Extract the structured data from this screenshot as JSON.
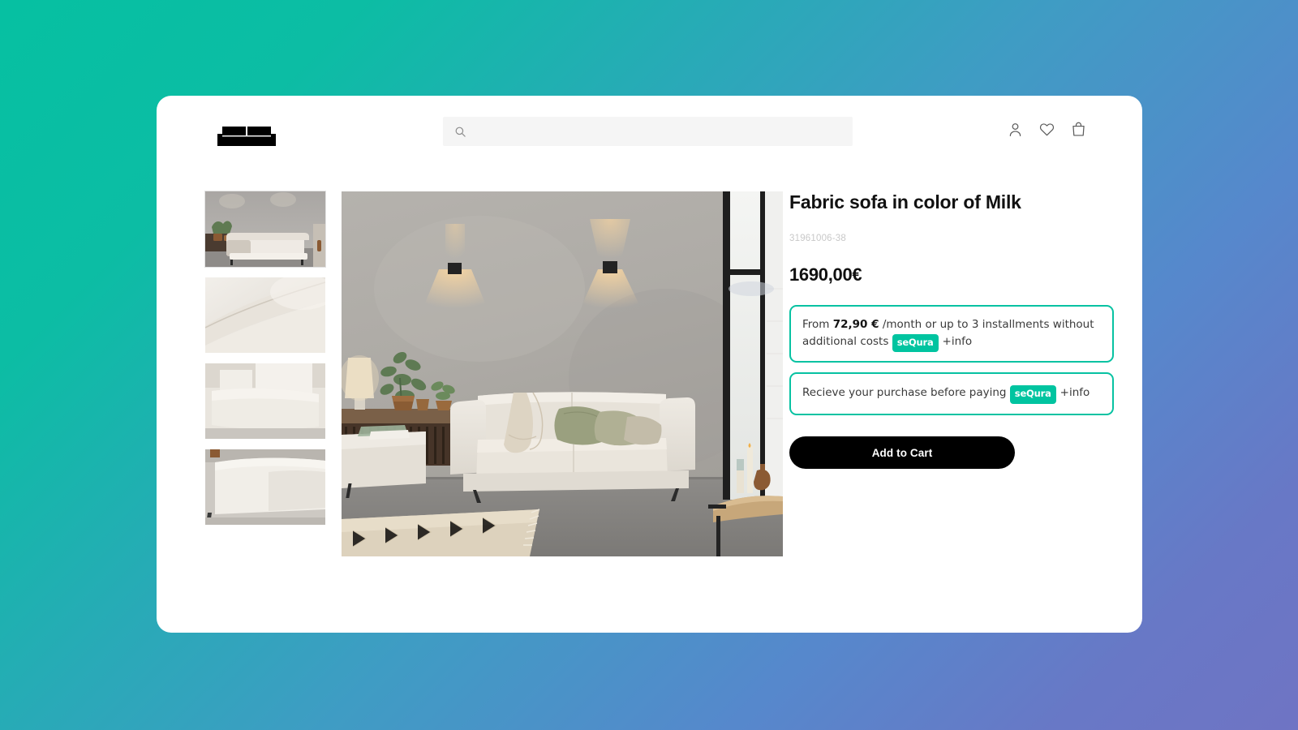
{
  "header": {
    "logo_name": "sofa-logo",
    "search": {
      "placeholder": "",
      "value": "",
      "icon": "search-icon"
    },
    "icons": [
      {
        "name": "account-icon",
        "label": "Account"
      },
      {
        "name": "wishlist-heart-icon",
        "label": "Wishlist"
      },
      {
        "name": "shopping-bag-icon",
        "label": "Cart"
      }
    ]
  },
  "gallery": {
    "thumbnails": [
      {
        "alt": "Sofa in living room wide view"
      },
      {
        "alt": "Close-up of sofa backrest seam"
      },
      {
        "alt": "Close-up of sofa armrest corner"
      },
      {
        "alt": "Sofa arm and leg detail"
      }
    ],
    "main_image": {
      "alt": "Beige fabric sofa in a concrete-wall living room with wall lamps, plants and rug"
    }
  },
  "product": {
    "title": "Fabric sofa in color of Milk",
    "sku": "31961006-38",
    "price": "1690,00€",
    "add_to_cart_label": "Add to Cart"
  },
  "promos": [
    {
      "name": "installments-promo",
      "prefix": "From ",
      "amount": "72,90 €",
      "suffix": " /month or up to 3 installments without additional costs",
      "badge": "seQura",
      "link": "+info"
    },
    {
      "name": "pay-later-promo",
      "prefix": "",
      "amount": "",
      "suffix": "Recieve your purchase before paying",
      "badge": "seQura",
      "link": "+info"
    }
  ],
  "colors": {
    "accent_green": "#07c2a2",
    "sequra_badge": "#00c4a0",
    "button_black": "#000000",
    "bg_gradient_start": "#06c0a2",
    "bg_gradient_end": "#6f74c4"
  }
}
